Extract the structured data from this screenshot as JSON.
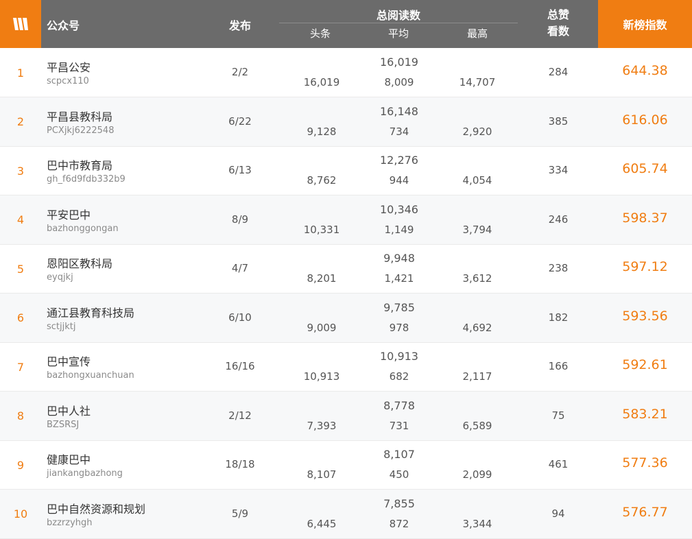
{
  "header": {
    "account": "公众号",
    "publish": "发布",
    "total_reads": "总阅读数",
    "headline": "头条",
    "average": "平均",
    "highest": "最高",
    "likes_line1": "总赞",
    "likes_line2": "看数",
    "index": "新榜指数"
  },
  "colors": {
    "accent": "#f07d12",
    "header_bg": "#6b6b6b"
  },
  "rows": [
    {
      "rank": "1",
      "name": "平昌公安",
      "id": "scpcx110",
      "publish": "2/2",
      "total": "16,019",
      "head": "16,019",
      "avg": "8,009",
      "max": "14,707",
      "likes": "284",
      "score": "644.38"
    },
    {
      "rank": "2",
      "name": "平昌县教科局",
      "id": "PCXjkj6222548",
      "publish": "6/22",
      "total": "16,148",
      "head": "9,128",
      "avg": "734",
      "max": "2,920",
      "likes": "385",
      "score": "616.06"
    },
    {
      "rank": "3",
      "name": "巴中市教育局",
      "id": "gh_f6d9fdb332b9",
      "publish": "6/13",
      "total": "12,276",
      "head": "8,762",
      "avg": "944",
      "max": "4,054",
      "likes": "334",
      "score": "605.74"
    },
    {
      "rank": "4",
      "name": "平安巴中",
      "id": "bazhonggongan",
      "publish": "8/9",
      "total": "10,346",
      "head": "10,331",
      "avg": "1,149",
      "max": "3,794",
      "likes": "246",
      "score": "598.37"
    },
    {
      "rank": "5",
      "name": "恩阳区教科局",
      "id": "eyqjkj",
      "publish": "4/7",
      "total": "9,948",
      "head": "8,201",
      "avg": "1,421",
      "max": "3,612",
      "likes": "238",
      "score": "597.12"
    },
    {
      "rank": "6",
      "name": "通江县教育科技局",
      "id": "sctjjktj",
      "publish": "6/10",
      "total": "9,785",
      "head": "9,009",
      "avg": "978",
      "max": "4,692",
      "likes": "182",
      "score": "593.56"
    },
    {
      "rank": "7",
      "name": "巴中宣传",
      "id": "bazhongxuanchuan",
      "publish": "16/16",
      "total": "10,913",
      "head": "10,913",
      "avg": "682",
      "max": "2,117",
      "likes": "166",
      "score": "592.61"
    },
    {
      "rank": "8",
      "name": "巴中人社",
      "id": "BZSRSJ",
      "publish": "2/12",
      "total": "8,778",
      "head": "7,393",
      "avg": "731",
      "max": "6,589",
      "likes": "75",
      "score": "583.21"
    },
    {
      "rank": "9",
      "name": "健康巴中",
      "id": "jiankangbazhong",
      "publish": "18/18",
      "total": "8,107",
      "head": "8,107",
      "avg": "450",
      "max": "2,099",
      "likes": "461",
      "score": "577.36"
    },
    {
      "rank": "10",
      "name": "巴中自然资源和规划",
      "id": "bzzrzyhgh",
      "publish": "5/9",
      "total": "7,855",
      "head": "6,445",
      "avg": "872",
      "max": "3,344",
      "likes": "94",
      "score": "576.77"
    }
  ]
}
